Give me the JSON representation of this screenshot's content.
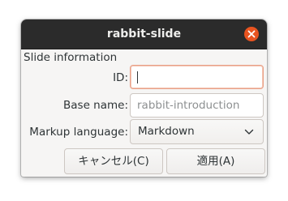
{
  "window": {
    "title": "rabbit-slide",
    "close_icon": "close-icon",
    "accent_color": "#e95420"
  },
  "form": {
    "section_label": "Slide information",
    "id": {
      "label": "ID:",
      "value": ""
    },
    "base_name": {
      "label": "Base name:",
      "placeholder": "rabbit-introduction"
    },
    "markup_language": {
      "label": "Markup language:",
      "selected": "Markdown",
      "dropdown_icon": "chevron-down-icon"
    }
  },
  "buttons": {
    "cancel_label": "キャンセル(C)",
    "apply_label": "適用(A)"
  }
}
